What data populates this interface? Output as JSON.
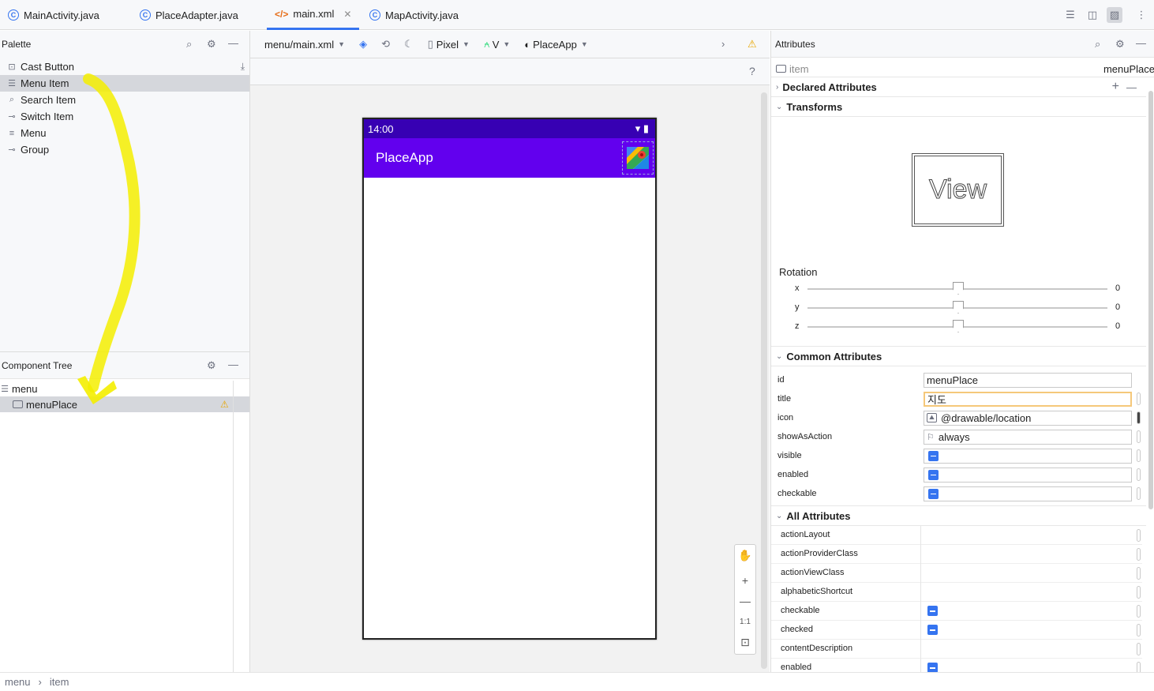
{
  "tabs": [
    {
      "label": "MainActivity.java"
    },
    {
      "label": "PlaceAdapter.java"
    },
    {
      "label": "main.xml"
    },
    {
      "label": "MapActivity.java"
    }
  ],
  "palette": {
    "title": "Palette",
    "items": [
      {
        "label": "Cast Button"
      },
      {
        "label": "Menu Item"
      },
      {
        "label": "Search Item"
      },
      {
        "label": "Switch Item"
      },
      {
        "label": "Menu"
      },
      {
        "label": "Group"
      }
    ]
  },
  "tree": {
    "title": "Component Tree",
    "root": "menu",
    "child": "menuPlace"
  },
  "toolbar": {
    "file": "menu/main.xml",
    "device": "Pixel",
    "api": "V",
    "theme": "PlaceApp"
  },
  "phone": {
    "time": "14:00",
    "app_title": "PlaceApp"
  },
  "attributes": {
    "title": "Attributes",
    "element": "item",
    "element_id": "menuPlace",
    "declared": "Declared Attributes",
    "transforms": "Transforms",
    "view_label": "View",
    "rotation": "Rotation",
    "rot_x_label": "x",
    "rot_x": "0",
    "rot_y_label": "y",
    "rot_y": "0",
    "rot_z_label": "z",
    "rot_z": "0",
    "common": "Common Attributes",
    "common_rows": {
      "id_label": "id",
      "id_value": "menuPlace",
      "title_label": "title",
      "title_value": "지도",
      "icon_label": "icon",
      "icon_value": "@drawable/location",
      "show_label": "showAsAction",
      "show_value": "always",
      "visible_label": "visible",
      "enabled_label": "enabled",
      "checkable_label": "checkable"
    },
    "all": "All Attributes",
    "all_rows": [
      "actionLayout",
      "actionProviderClass",
      "actionViewClass",
      "alphabeticShortcut",
      "checkable",
      "checked",
      "contentDescription",
      "enabled"
    ]
  },
  "breadcrumb": {
    "a": "menu",
    "sep": "›",
    "b": "item"
  },
  "accent": "#3574f0",
  "appbar_color": "#6200ee",
  "statusbar_color": "#3700b3",
  "annotation_color": "#f4ee00"
}
